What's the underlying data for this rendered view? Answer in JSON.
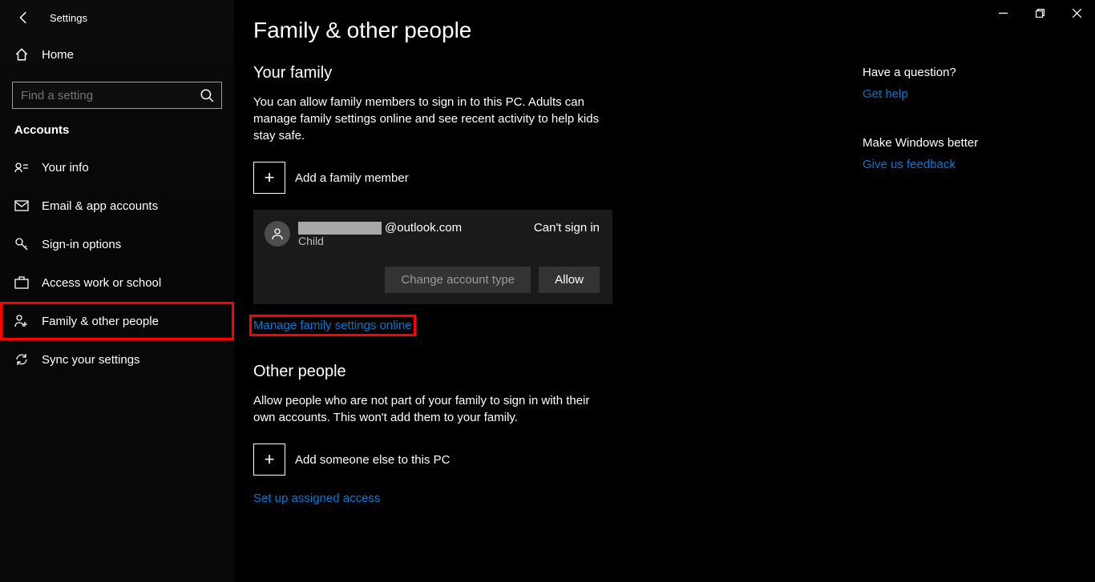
{
  "app_title": "Settings",
  "home_label": "Home",
  "search_placeholder": "Find a setting",
  "category": "Accounts",
  "nav": [
    {
      "label": "Your info"
    },
    {
      "label": "Email & app accounts"
    },
    {
      "label": "Sign-in options"
    },
    {
      "label": "Access work or school"
    },
    {
      "label": "Family & other people"
    },
    {
      "label": "Sync your settings"
    }
  ],
  "page_title": "Family & other people",
  "family": {
    "heading": "Your family",
    "desc": "You can allow family members to sign in to this PC. Adults can manage family settings online and see recent activity to help kids stay safe.",
    "add_label": "Add a family member",
    "member_email_suffix": "@outlook.com",
    "member_role": "Child",
    "member_status": "Can't sign in",
    "btn_change": "Change account type",
    "btn_allow": "Allow",
    "manage_link": "Manage family settings online"
  },
  "other": {
    "heading": "Other people",
    "desc": "Allow people who are not part of your family to sign in with their own accounts. This won't add them to your family.",
    "add_label": "Add someone else to this PC",
    "assigned_link": "Set up assigned access"
  },
  "help": {
    "question": "Have a question?",
    "get_help": "Get help",
    "better": "Make Windows better",
    "feedback": "Give us feedback"
  }
}
